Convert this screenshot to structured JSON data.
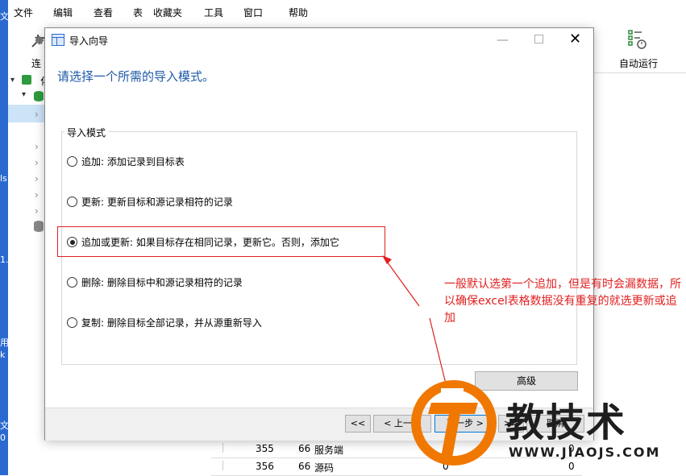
{
  "menubar": {
    "items": [
      "文件",
      "编辑",
      "查看",
      "表",
      "收藏夹",
      "工具",
      "窗口",
      "帮助"
    ]
  },
  "desktop": {
    "labels": [
      "文",
      "ls",
      "1.",
      "用",
      "k",
      "文",
      "0"
    ]
  },
  "toolbar": {
    "connect_label": "连",
    "auto_run_label": "自动运行"
  },
  "tree": {
    "truncated_label": "化"
  },
  "background_grid": {
    "rows": [
      {
        "id": "355",
        "count": "66",
        "name": "服务端",
        "a": "0",
        "b": "0"
      },
      {
        "id": "356",
        "count": "66",
        "name": "源码",
        "a": "0",
        "b": "0"
      }
    ]
  },
  "dialog": {
    "title": "导入向导",
    "minimize_glyph": "—",
    "maximize_glyph": "☐",
    "close_glyph": "✕",
    "header": "请选择一个所需的导入模式。",
    "group_title": "导入模式",
    "options": [
      {
        "label": "追加: 添加记录到目标表",
        "checked": false
      },
      {
        "label": "更新: 更新目标和源记录相符的记录",
        "checked": false
      },
      {
        "label": "追加或更新: 如果目标存在相同记录，更新它。否则，添加它",
        "checked": true
      },
      {
        "label": "删除: 删除目标中和源记录相符的记录",
        "checked": false
      },
      {
        "label": "复制: 删除目标全部记录，并从源重新导入",
        "checked": false
      }
    ],
    "advanced_label": "高级",
    "footer": {
      "first_label": "<<",
      "prev_label": "< 上一步",
      "next_label": "下一步 >",
      "last_label": ">>",
      "cancel_label": "取消"
    }
  },
  "annotation": {
    "text": "一般默认选第一个追加，但是有时会漏数据，所以确保excel表格数据没有重复的就选更新或追加",
    "color": "#e02020"
  },
  "watermark": {
    "brand": "教技术",
    "url": "WWW.JIAOJS.COM",
    "accent": "#f07800"
  }
}
